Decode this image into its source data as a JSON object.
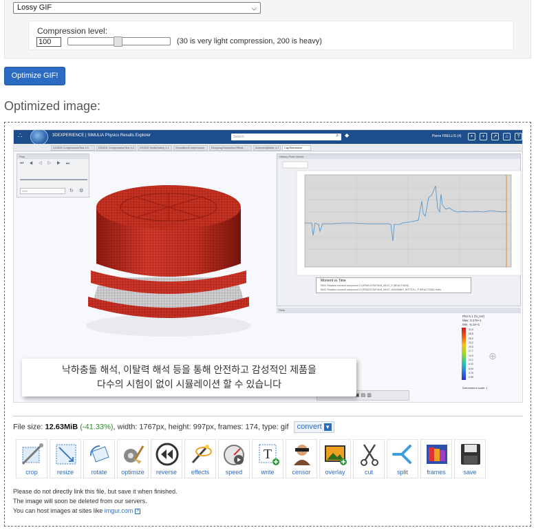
{
  "options": {
    "method_selected": "Lossy GIF",
    "compression_label": "Compression level:",
    "compression_value": "100",
    "compression_hint": "(30 is very light compression, 200 is heavy)",
    "compression_slider_level": 0.45
  },
  "optimize_button": "Optimize GIF!",
  "section_title": "Optimized image:",
  "preview": {
    "app_title": "3DEXPERIENCE | SIMULIA Physics Results Explorer",
    "search_placeholder": "Search",
    "user": "Pierre FRELLIS (4)",
    "tabs": [
      "DS3DS CompressionTest 4.1",
      "DS3DS CompressionTest 4.2",
      "DS3DS RadioSafety 4.1",
      "SimulationCompression",
      "DroppingSimulationOfBott...",
      "AssemblyBottle 4.1",
      "CapSimulation"
    ],
    "play_header": "Play",
    "play_field": "0/24",
    "plot_header": "History Plots Viewer",
    "legend_title": "Moment vs Time",
    "legend_lines": [
      "RM3, Reaction moment component 3 LDRM1/CONFIG/M_MULT_P   (REACTIONS)",
      "RM3, Reaction moment component 3 LDRM2/CONFIG/M_MULT_ASSEMBLY_BOTTLE=_P   (REACTIONS-Hide)"
    ],
    "x_axis_label": "Time (s)",
    "y_axis_label": "Moment (N.mm)",
    "info_header": "Plots",
    "colorbar_title": "Plot S.1 (N_m2)",
    "colorbar_max": "Max: 3.17e+1",
    "colorbar_min": "Min: -5.1e+1",
    "colorbar_ticks": [
      "31.6",
      "28.8",
      "26.0",
      "23.2",
      "20.4",
      "17.7",
      "14.9",
      "12.1",
      "9.32",
      "6.54",
      "3.76",
      "0.98"
    ],
    "deformation_scale": "Deformation scale: 1",
    "caption_line1": "낙하충돌 해석, 이탈력 해석 등을 통해 안전하고 감성적인 제품을",
    "caption_line2": "다수의 시험이 없이 시뮬레이션 할 수 있습니다"
  },
  "file_info": {
    "prefix": "File size: ",
    "size": "12.63MiB",
    "reduction": "(-41.33%)",
    "rest": ", width: 1767px, height: 997px, frames: 174, type: gif",
    "convert_label": "convert"
  },
  "tools": [
    {
      "label": "crop",
      "icon": "crop-icon"
    },
    {
      "label": "resize",
      "icon": "resize-icon"
    },
    {
      "label": "rotate",
      "icon": "rotate-icon"
    },
    {
      "label": "optimize",
      "icon": "optimize-icon"
    },
    {
      "label": "reverse",
      "icon": "reverse-icon"
    },
    {
      "label": "effects",
      "icon": "effects-icon"
    },
    {
      "label": "speed",
      "icon": "speed-icon"
    },
    {
      "label": "write",
      "icon": "write-icon"
    },
    {
      "label": "censor",
      "icon": "censor-icon"
    },
    {
      "label": "overlay",
      "icon": "overlay-icon"
    },
    {
      "label": "cut",
      "icon": "cut-icon"
    },
    {
      "label": "split",
      "icon": "split-icon"
    },
    {
      "label": "frames",
      "icon": "frames-icon"
    },
    {
      "label": "save",
      "icon": "save-icon"
    }
  ],
  "notes": {
    "line1": "Please do not directly link this file, but save it when finished.",
    "line2": "The image will soon be deleted from our servers.",
    "line3_prefix": "You can host images at sites like ",
    "line3_link": "imgur.com"
  }
}
